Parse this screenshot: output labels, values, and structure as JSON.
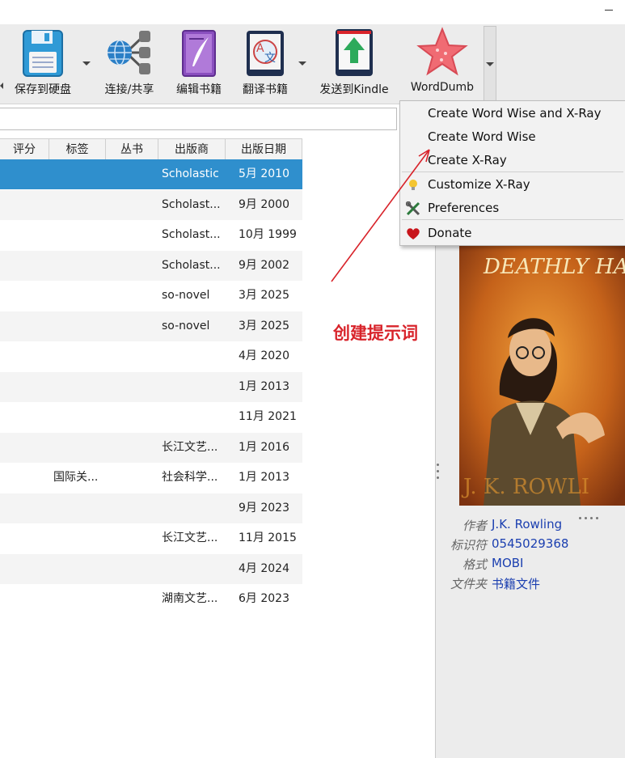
{
  "toolbar": {
    "items": [
      {
        "label": "保存到硬盘",
        "icon": "floppy-disk-icon"
      },
      {
        "label": "连接/共享",
        "icon": "network-share-icon"
      },
      {
        "label": "编辑书籍",
        "icon": "edit-book-icon"
      },
      {
        "label": "翻译书籍",
        "icon": "translate-book-icon"
      },
      {
        "label": "发送到Kindle",
        "icon": "send-to-kindle-icon"
      },
      {
        "label": "WordDumb",
        "icon": "worddumb-star-icon"
      }
    ]
  },
  "table": {
    "columns": [
      "评分",
      "标签",
      "丛书",
      "出版商",
      "出版日期"
    ],
    "rows": [
      {
        "tags": "",
        "publisher": "Scholastic",
        "date": "5月 2010"
      },
      {
        "tags": "",
        "publisher": "Scholast...",
        "date": "9月 2000"
      },
      {
        "tags": "",
        "publisher": "Scholast...",
        "date": "10月 1999"
      },
      {
        "tags": "",
        "publisher": "Scholast...",
        "date": "9月 2002"
      },
      {
        "tags": "",
        "publisher": "so-novel",
        "date": "3月 2025"
      },
      {
        "tags": "",
        "publisher": "so-novel",
        "date": "3月 2025"
      },
      {
        "tags": "",
        "publisher": "",
        "date": "4月 2020"
      },
      {
        "tags": "",
        "publisher": "",
        "date": "1月 2013"
      },
      {
        "tags": "",
        "publisher": "",
        "date": "11月 2021"
      },
      {
        "tags": "",
        "publisher": "长江文艺...",
        "date": "1月 2016"
      },
      {
        "tags": "国际关...",
        "publisher": "社会科学...",
        "date": "1月 2013"
      },
      {
        "tags": "",
        "publisher": "",
        "date": "9月 2023"
      },
      {
        "tags": "",
        "publisher": "长江文艺...",
        "date": "11月 2015"
      },
      {
        "tags": "",
        "publisher": "",
        "date": "4月 2024"
      },
      {
        "tags": "",
        "publisher": "湖南文艺...",
        "date": "6月 2023"
      }
    ]
  },
  "menu": {
    "items": [
      {
        "label": "Create Word Wise and X-Ray",
        "icon": ""
      },
      {
        "label": "Create Word Wise",
        "icon": ""
      },
      {
        "label": "Create X-Ray",
        "icon": ""
      },
      {
        "label": "Customize X-Ray",
        "icon": "lightbulb-icon"
      },
      {
        "label": "Preferences",
        "icon": "tools-icon"
      },
      {
        "label": "Donate",
        "icon": "heart-icon"
      }
    ]
  },
  "annotation": {
    "text": "创建提示词",
    "color": "#d8232a"
  },
  "details": {
    "cover_text_top": "DEATHLY HALLOWS",
    "cover_text_bottom": "J. K. ROWLI",
    "author_label": "作者",
    "author": "J.K. Rowling",
    "id_label": "标识符",
    "id": "0545029368",
    "format_label": "格式",
    "format": "MOBI",
    "folder_label": "文件夹",
    "folder": "书籍文件"
  },
  "colors": {
    "selection": "#2f8fcd",
    "link": "#1b3fb0"
  }
}
